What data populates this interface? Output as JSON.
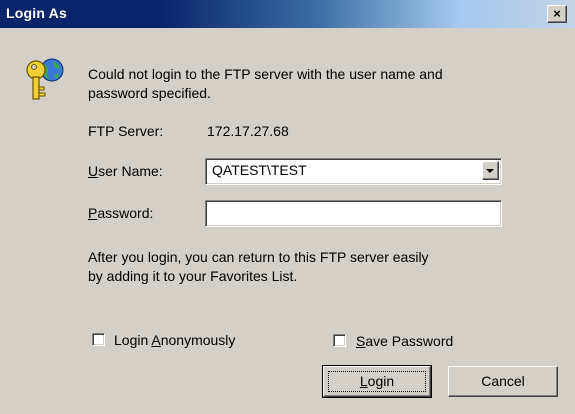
{
  "window": {
    "title": "Login As",
    "close_glyph": "×"
  },
  "message": {
    "line1": "Could not login to the FTP server with the user name and",
    "line2": "password specified.",
    "icon": "key-icon"
  },
  "ftp_server": {
    "label": "FTP Server:",
    "value": "172.17.27.68"
  },
  "user_name": {
    "label_mnemonic": "U",
    "label_rest": "ser Name:",
    "value": "QATEST\\TEST"
  },
  "password": {
    "label_mnemonic": "P",
    "label_rest": "assword:",
    "value": ""
  },
  "info": {
    "line1": "After you login, you can return to this FTP server easily",
    "line2": "by adding it to your Favorites List."
  },
  "login_anonymously": {
    "label_before": "Login ",
    "label_mnemonic": "A",
    "label_rest": "nonymously",
    "checked": false
  },
  "save_password": {
    "label_mnemonic": "S",
    "label_rest": "ave Password",
    "checked": false
  },
  "buttons": {
    "login_mnemonic": "L",
    "login_rest": "ogin",
    "cancel": "Cancel"
  }
}
